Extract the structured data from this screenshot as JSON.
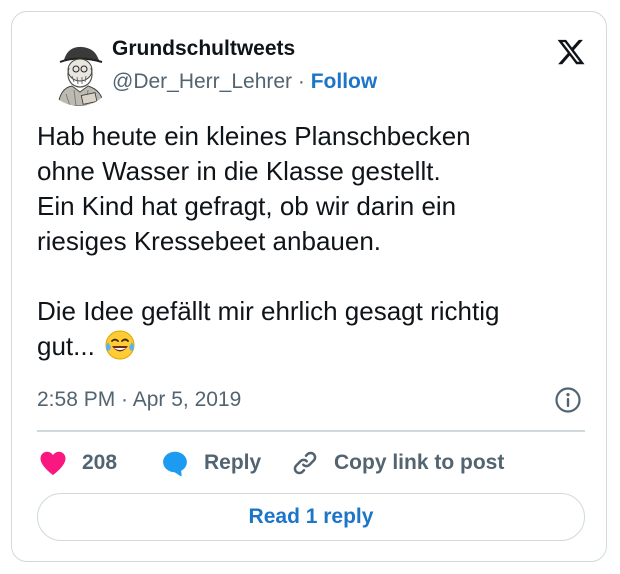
{
  "author": {
    "display_name": "Grundschultweets",
    "handle": "@Der_Herr_Lehrer",
    "separator": " · ",
    "follow_label": "Follow",
    "avatar_icon": "engraving-portrait-avatar"
  },
  "platform": {
    "logo_icon": "x-logo-icon"
  },
  "tweet": {
    "text": "Hab heute ein kleines Planschbecken\nohne Wasser in die Klasse gestellt.\nEin Kind hat gefragt, ob wir darin ein\nriesiges Kressebeet anbauen.\n\nDie Idee gefällt mir ehrlich gesagt richtig\ngut... ",
    "emoji_icon": "face-with-tears-of-joy-emoji",
    "timestamp": "2:58 PM · Apr 5, 2019"
  },
  "actions": {
    "like_count": "208",
    "reply_label": "Reply",
    "copy_label": "Copy link to post"
  },
  "footer": {
    "read_replies_label": "Read 1 reply"
  },
  "colors": {
    "like": "#f91880",
    "reply": "#1d9bf0",
    "link": "#1d75c8",
    "muted": "#536471",
    "text": "#0f1419",
    "border": "#cfd9de"
  }
}
